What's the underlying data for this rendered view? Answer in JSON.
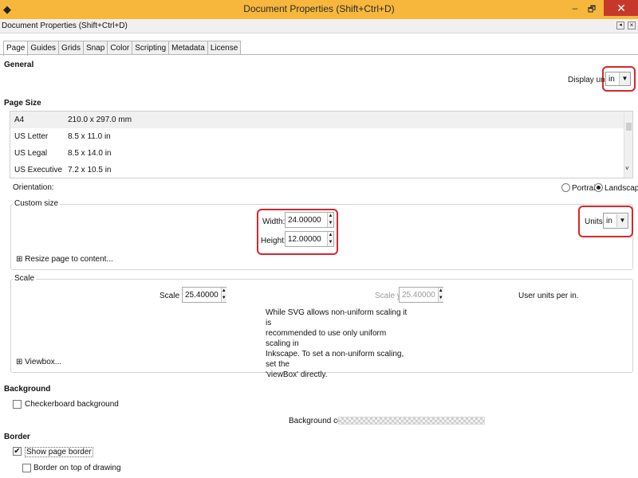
{
  "window": {
    "title": "Document Properties (Shift+Ctrl+D)",
    "min_glyph": "–",
    "max_glyph": "🗗",
    "close_glyph": "✕",
    "app_icon_glyph": "◆"
  },
  "dock": {
    "title": "Document Properties (Shift+Ctrl+D)",
    "btn1": "◂",
    "btn2": "×"
  },
  "tabs": [
    "Page",
    "Guides",
    "Grids",
    "Snap",
    "Color",
    "Scripting",
    "Metadata",
    "License"
  ],
  "general": {
    "heading": "General",
    "display_units_label": "Display units:",
    "display_units_value": "in"
  },
  "page_size": {
    "heading": "Page Size",
    "rows": [
      {
        "name": "A4",
        "dims": "210.0 x 297.0 mm"
      },
      {
        "name": "US Letter",
        "dims": "8.5 x 11.0 in"
      },
      {
        "name": "US Legal",
        "dims": "8.5 x 14.0 in"
      },
      {
        "name": "US Executive",
        "dims": "7.2 x 10.5 in"
      }
    ],
    "orientation_label": "Orientation:",
    "portrait_label": "Portrait",
    "landscape_label": "Landscape",
    "selected_orientation": "Landscape"
  },
  "custom_size": {
    "title": "Custom size",
    "width_label": "Width:",
    "width_value": "24.00000",
    "height_label": "Height:",
    "height_value": "12.00000",
    "units_label": "Units:",
    "units_value": "in",
    "resize_label": "Resize page to content..."
  },
  "scale": {
    "title": "Scale",
    "scale_x_label": "Scale x:",
    "scale_x_value": "25.40000",
    "scale_y_label": "Scale y:",
    "scale_y_value": "25.40000",
    "user_units_label": "User units per in.",
    "note_lines": [
      "While SVG allows non-uniform scaling it is",
      "recommended to use only uniform scaling in",
      "Inkscape. To set a non-uniform scaling, set the",
      "'viewBox' directly."
    ],
    "viewbox_label": "Viewbox..."
  },
  "background": {
    "heading": "Background",
    "checkerboard_label": "Checkerboard background",
    "checkerboard_checked": false,
    "color_label": "Background color:"
  },
  "border": {
    "heading": "Border",
    "show_border_label": "Show page border",
    "show_border_checked": true,
    "on_top_label": "Border on top of drawing",
    "on_top_checked": false
  },
  "colors": {
    "titlebar": "#f6b73c",
    "close": "#c7382c",
    "annotation_red": "#d8262b"
  }
}
